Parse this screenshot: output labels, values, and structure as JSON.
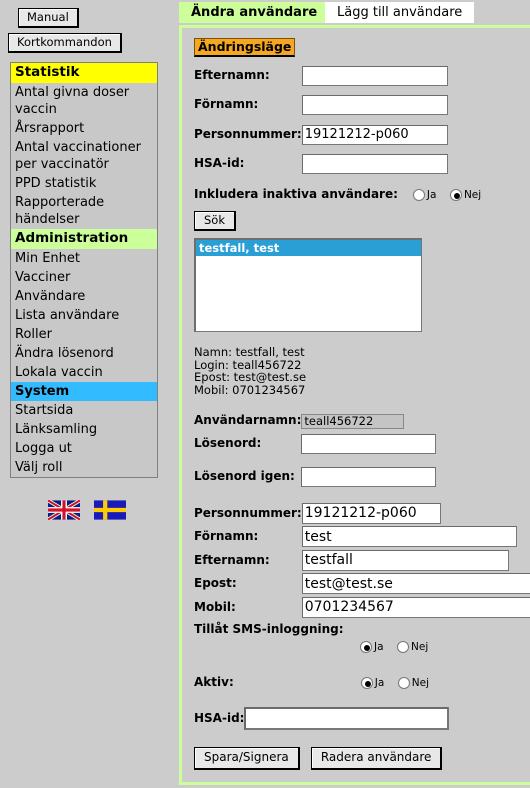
{
  "toolbar": {
    "manual_label": "Manual",
    "shortcuts_label": "Kortkommandon"
  },
  "sidebar": {
    "sections": [
      {
        "heading": "Statistik",
        "heading_color": "#ffff00",
        "items": [
          {
            "label": "Antal givna doser vaccin",
            "selected": false
          },
          {
            "label": "Årsrapport",
            "selected": false
          },
          {
            "label": "Antal vaccinationer per vaccinatör",
            "selected": false
          },
          {
            "label": "PPD statistik",
            "selected": false
          },
          {
            "label": "Rapporterade händelser",
            "selected": false
          }
        ]
      },
      {
        "heading": "Administration",
        "heading_color": "#ccff99",
        "items": [
          {
            "label": "Min Enhet",
            "selected": false
          },
          {
            "label": "Vacciner",
            "selected": false
          },
          {
            "label": "Användare",
            "selected": false
          },
          {
            "label": "Lista användare",
            "selected": false
          },
          {
            "label": "Roller",
            "selected": false
          },
          {
            "label": "Ändra lösenord",
            "selected": false
          },
          {
            "label": "Lokala vaccin",
            "selected": false
          }
        ]
      },
      {
        "heading": "System",
        "heading_color": "#33bbff",
        "heading_selected": true,
        "items": [
          {
            "label": "Startsida",
            "selected": false
          },
          {
            "label": "Länksamling",
            "selected": false
          },
          {
            "label": "Logga ut",
            "selected": false
          },
          {
            "label": "Välj roll",
            "selected": false
          }
        ]
      }
    ],
    "flags": [
      {
        "name": "uk-flag",
        "title": "English"
      },
      {
        "name": "sweden-flag",
        "title": "Svenska"
      }
    ]
  },
  "tabs": [
    {
      "label": "Ändra användare",
      "active": true
    },
    {
      "label": "Lägg till användare",
      "active": false
    }
  ],
  "mode_badge": "Ändringsläge",
  "search_form": {
    "fields": [
      {
        "label": "Efternamn:",
        "value": ""
      },
      {
        "label": "Förnamn:",
        "value": ""
      },
      {
        "label": "Personnummer:",
        "value": "19121212-p060"
      },
      {
        "label": "HSA-id:",
        "value": ""
      }
    ],
    "include_inactive_label": "Inkludera inaktiva användare:",
    "yes_label": "Ja",
    "no_label": "Nej",
    "include_inactive_value": "Nej",
    "search_button": "Sök"
  },
  "results": {
    "options": [
      {
        "label": "testfall, test",
        "selected": true
      }
    ]
  },
  "details": {
    "namn": "Namn: testfall, test",
    "login": "Login: teall456722",
    "epost": "Epost: test@test.se",
    "mobil": "Mobil: 0701234567"
  },
  "account": {
    "username_label": "Användarnamn:",
    "username_value": "teall456722",
    "password_label": "Lösenord:",
    "password_value": "",
    "password_repeat_label": "Lösenord igen:",
    "password_repeat_value": ""
  },
  "edit_form": {
    "personnummer_label": "Personnummer:",
    "personnummer_value": "19121212-p060",
    "fornamn_label": "Förnamn:",
    "fornamn_value": "test",
    "efternamn_label": "Efternamn:",
    "efternamn_value": "testfall",
    "epost_label": "Epost:",
    "epost_value": "test@test.se",
    "mobil_label": "Mobil:",
    "mobil_value": "0701234567",
    "sms_label": "Tillåt SMS-inloggning:",
    "sms_value": "Ja",
    "aktiv_label": "Aktiv:",
    "aktiv_value": "Ja",
    "hsa_label": "HSA-id:",
    "hsa_value": "",
    "yes_label": "Ja",
    "no_label": "Nej"
  },
  "actions": {
    "save_label": "Spara/Signera",
    "delete_label": "Radera användare"
  }
}
